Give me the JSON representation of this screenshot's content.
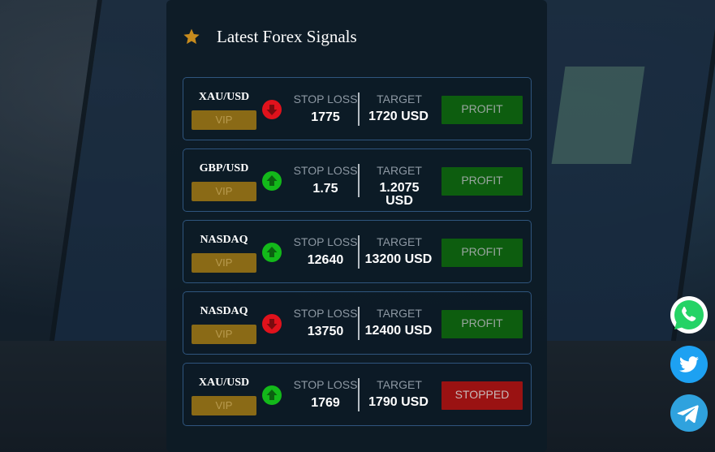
{
  "header": {
    "title": "Latest Forex Signals",
    "icon": "star-icon",
    "icon_color": "#c78b1d"
  },
  "labels": {
    "stop_loss": "STOP LOSS",
    "target": "TARGET"
  },
  "colors": {
    "up": "#13b91a",
    "down": "#e0121c",
    "vip": "#8a6a16",
    "profit": "#0d5d0f",
    "stopped": "#9a1212",
    "card_border": "#2f557e"
  },
  "signals": [
    {
      "pair": "XAU/USD",
      "tier": "VIP",
      "direction": "down",
      "stop_loss": "1775",
      "target": "1720 USD",
      "status": "PROFIT"
    },
    {
      "pair": "GBP/USD",
      "tier": "VIP",
      "direction": "up",
      "stop_loss": "1.75",
      "target": "1.2075 USD",
      "status": "PROFIT"
    },
    {
      "pair": "NASDAQ",
      "tier": "VIP",
      "direction": "up",
      "stop_loss": "12640",
      "target": "13200 USD",
      "status": "PROFIT"
    },
    {
      "pair": "NASDAQ",
      "tier": "VIP",
      "direction": "down",
      "stop_loss": "13750",
      "target": "12400 USD",
      "status": "PROFIT"
    },
    {
      "pair": "XAU/USD",
      "tier": "VIP",
      "direction": "up",
      "stop_loss": "1769",
      "target": "1790 USD",
      "status": "STOPPED"
    }
  ],
  "social": [
    {
      "name": "whatsapp",
      "icon": "whatsapp-icon",
      "color": "#25d366"
    },
    {
      "name": "twitter",
      "icon": "twitter-icon",
      "color": "#1da1f2"
    },
    {
      "name": "telegram",
      "icon": "telegram-icon",
      "color": "#2fa2de"
    }
  ]
}
